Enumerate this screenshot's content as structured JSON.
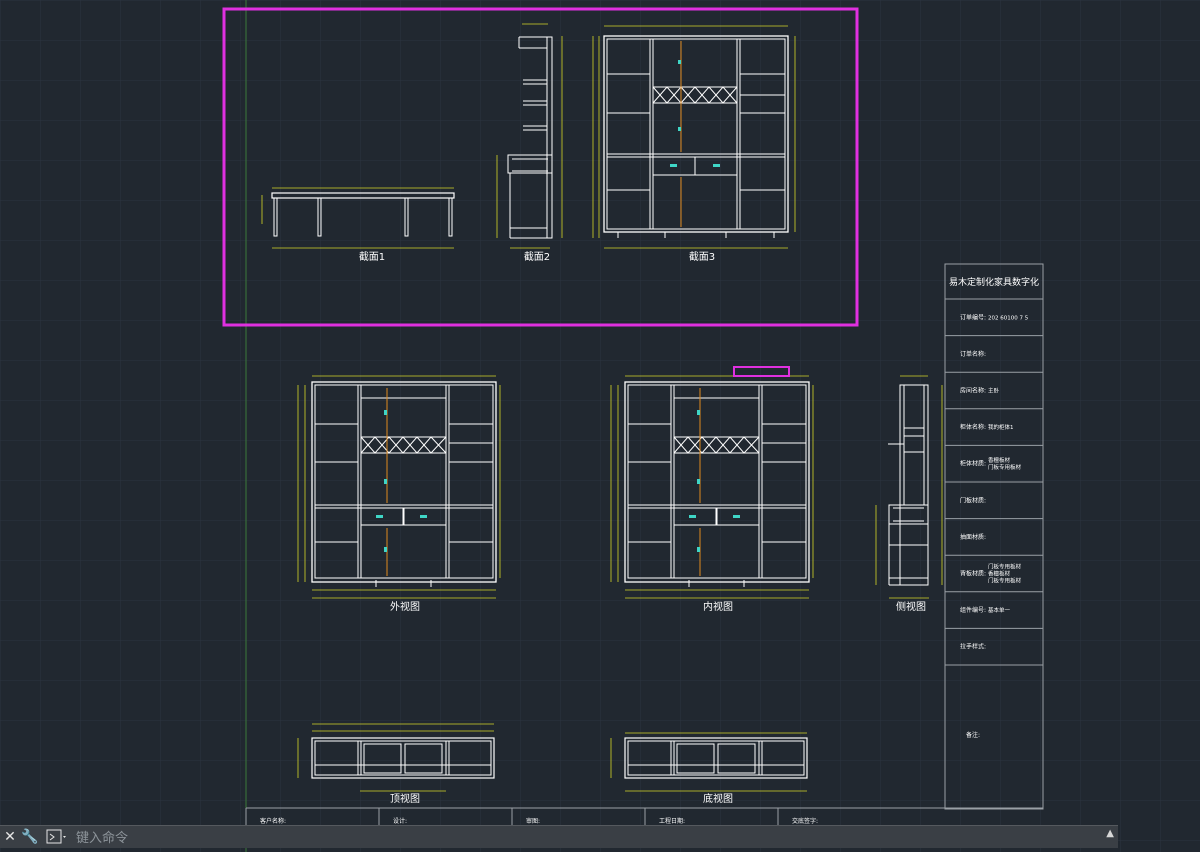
{
  "drawing": {
    "views": {
      "section1": "截面1",
      "section2": "截面2",
      "section3": "截面3",
      "front": "外视图",
      "inner": "内视图",
      "side": "侧视图",
      "top": "顶视图",
      "bottom": "底视图"
    },
    "title_block": {
      "company": "易木定制化家具数字化",
      "rows": [
        {
          "label": "订单编号:",
          "value": "202 60100 7 5"
        },
        {
          "label": "订单名称:",
          "value": ""
        },
        {
          "label": "房间名称:",
          "value": "主卧"
        },
        {
          "label": "柜体名称:",
          "value": "我的柜体1"
        },
        {
          "label": "柜体材质:",
          "value": "香檀板材 / 门板专用板材"
        },
        {
          "label": "门板材质:",
          "value": ""
        },
        {
          "label": "抽面材质:",
          "value": ""
        },
        {
          "label": "背板材质:",
          "value": "门板专用板材 / 香檀板材 / 门板专用板材"
        },
        {
          "label": "组件编号:",
          "value": "基本单一"
        },
        {
          "label": "拉手样式:",
          "value": ""
        },
        {
          "label": "备注:",
          "value": ""
        }
      ]
    },
    "bottom_strip": [
      "客户名称:",
      "设计:",
      "审图:",
      "工程日期:",
      "交底签字:"
    ]
  },
  "command_line": {
    "placeholder": "键入命令",
    "close_icon": "close-icon",
    "settings_icon": "wrench-icon",
    "prompt_icon": "command-prompt-icon",
    "expand_icon": "triangle-up-icon"
  },
  "colors": {
    "background": "#212830",
    "grid": "#2c3440",
    "lines": "#ffffff",
    "dimensions": "#d6d629",
    "dimension_text": "#34c834",
    "selection": "#e030e0",
    "hardware": "#3fd6c6",
    "door_line": "#e08a1e"
  }
}
